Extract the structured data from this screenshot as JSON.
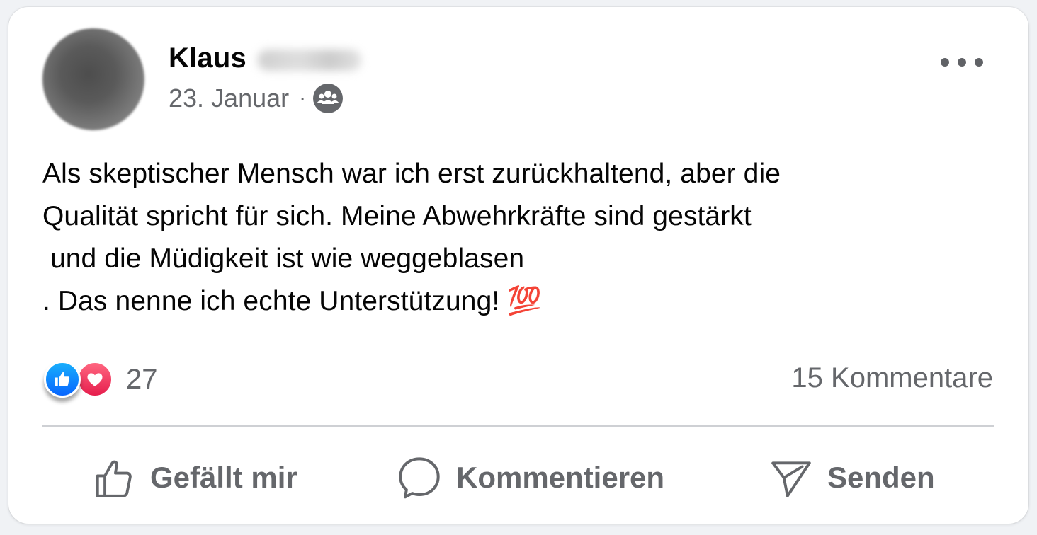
{
  "post": {
    "author_first_name": "Klaus",
    "date": "23. Januar",
    "separator": "·",
    "audience_icon": "group-icon",
    "body": "Als skeptischer Mensch war ich erst zurückhaltend, aber die\nQualität spricht für sich. Meine Abwehrkräfte sind gestärkt\n und die Müdigkeit ist wie weggeblasen\n. Das nenne ich echte Unterstützung! 💯",
    "reactions": {
      "icons": [
        "like-reaction-icon",
        "love-reaction-icon"
      ],
      "count": "27"
    },
    "comments_count": "15 Kommentare"
  },
  "actions": {
    "like_label": "Gefällt mir",
    "comment_label": "Kommentieren",
    "send_label": "Senden"
  },
  "colors": {
    "like_blue": "#0866ff",
    "love_red": "#f33e58",
    "secondary_text": "#65676b",
    "primary_text": "#050505"
  }
}
